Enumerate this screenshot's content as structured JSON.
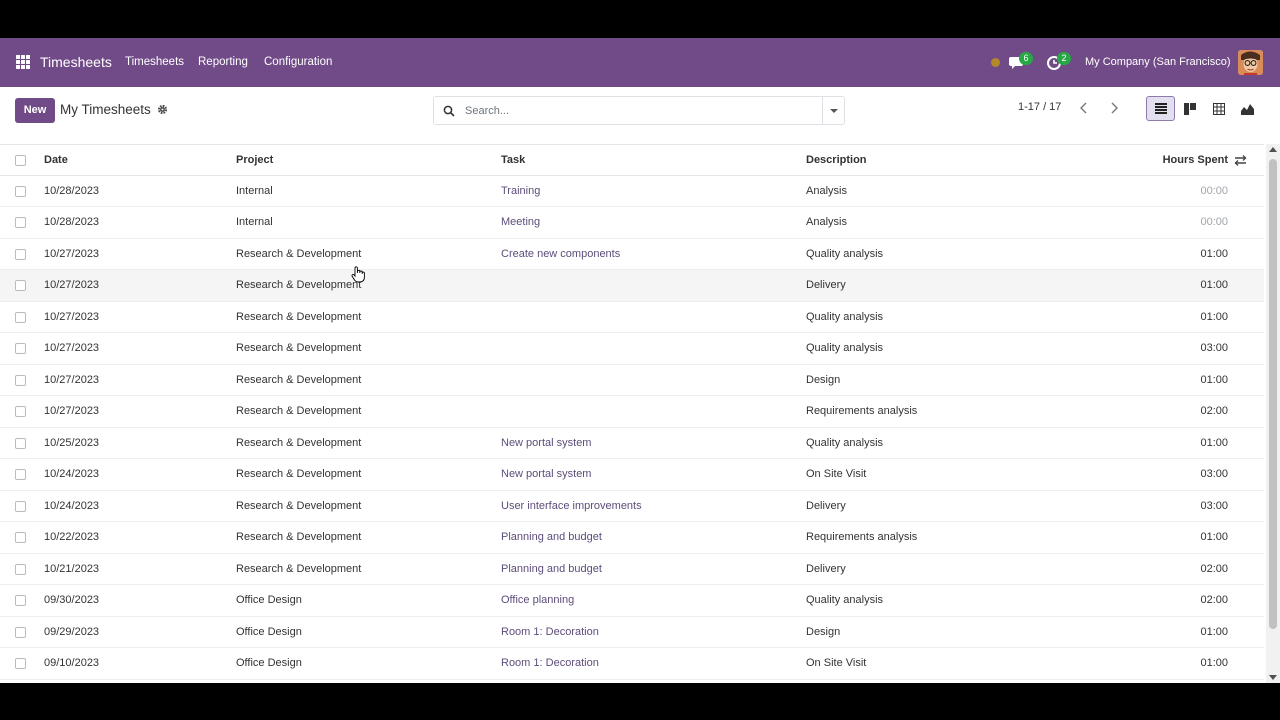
{
  "navbar": {
    "app_name": "Timesheets",
    "menu": [
      "Timesheets",
      "Reporting",
      "Configuration"
    ],
    "messages_count": "6",
    "activities_count": "2",
    "company": "My Company (San Francisco)"
  },
  "control": {
    "new_label": "New",
    "title": "My Timesheets",
    "search_placeholder": "Search...",
    "pager": "1-17 / 17",
    "views": [
      "list-view-icon",
      "kanban-view-icon",
      "pivot-view-icon",
      "graph-view-icon"
    ],
    "active_view": "list-view-icon"
  },
  "table": {
    "headers": {
      "date": "Date",
      "project": "Project",
      "task": "Task",
      "description": "Description",
      "hours": "Hours Spent"
    },
    "rows": [
      {
        "date": "10/28/2023",
        "project": "Internal",
        "task": "Training",
        "description": "Analysis",
        "hours": "00:00"
      },
      {
        "date": "10/28/2023",
        "project": "Internal",
        "task": "Meeting",
        "description": "Analysis",
        "hours": "00:00"
      },
      {
        "date": "10/27/2023",
        "project": "Research & Development",
        "task": "Create new components",
        "description": "Quality analysis",
        "hours": "01:00"
      },
      {
        "date": "10/27/2023",
        "project": "Research & Development",
        "task": "",
        "description": "Delivery",
        "hours": "01:00"
      },
      {
        "date": "10/27/2023",
        "project": "Research & Development",
        "task": "",
        "description": "Quality analysis",
        "hours": "01:00"
      },
      {
        "date": "10/27/2023",
        "project": "Research & Development",
        "task": "",
        "description": "Quality analysis",
        "hours": "03:00"
      },
      {
        "date": "10/27/2023",
        "project": "Research & Development",
        "task": "",
        "description": "Design",
        "hours": "01:00"
      },
      {
        "date": "10/27/2023",
        "project": "Research & Development",
        "task": "",
        "description": "Requirements analysis",
        "hours": "02:00"
      },
      {
        "date": "10/25/2023",
        "project": "Research & Development",
        "task": "New portal system",
        "description": "Quality analysis",
        "hours": "01:00"
      },
      {
        "date": "10/24/2023",
        "project": "Research & Development",
        "task": "New portal system",
        "description": "On Site Visit",
        "hours": "03:00"
      },
      {
        "date": "10/24/2023",
        "project": "Research & Development",
        "task": "User interface improvements",
        "description": "Delivery",
        "hours": "03:00"
      },
      {
        "date": "10/22/2023",
        "project": "Research & Development",
        "task": "Planning and budget",
        "description": "Requirements analysis",
        "hours": "01:00"
      },
      {
        "date": "10/21/2023",
        "project": "Research & Development",
        "task": "Planning and budget",
        "description": "Delivery",
        "hours": "02:00"
      },
      {
        "date": "09/30/2023",
        "project": "Office Design",
        "task": "Office planning",
        "description": "Quality analysis",
        "hours": "02:00"
      },
      {
        "date": "09/29/2023",
        "project": "Office Design",
        "task": "Room 1: Decoration",
        "description": "Design",
        "hours": "01:00"
      },
      {
        "date": "09/10/2023",
        "project": "Office Design",
        "task": "Room 1: Decoration",
        "description": "On Site Visit",
        "hours": "01:00"
      }
    ]
  },
  "colors": {
    "brand": "#714b88",
    "badge": "#28a745",
    "task_link": "#5d4d7a"
  }
}
